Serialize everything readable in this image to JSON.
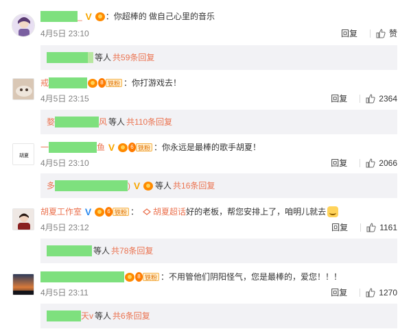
{
  "comments": [
    {
      "text": "：你超棒的 做自己心里的音乐",
      "time": "4月5日 23:10",
      "reply": "回复",
      "likes": "赞",
      "sub_who": "等人",
      "sub_count": "共59条回复"
    },
    {
      "name_prefix": "戒",
      "fan_tag": "铁粉",
      "text": "：你打游戏去！",
      "time": "4月5日 23:15",
      "reply": "回复",
      "likes": "2364",
      "sub_prefix": "婺",
      "sub_suffix": "风",
      "sub_who": "等人",
      "sub_count": "共110条回复"
    },
    {
      "name_prefix": "一",
      "name_suffix": "鱼",
      "fan_tag": "铁粉",
      "text": "：你永远是最棒的歌手胡夏！",
      "time": "4月5日 23:10",
      "reply": "回复",
      "likes": "2066",
      "sub_prefix": "多",
      "sub_who": "等人",
      "sub_count": "共16条回复"
    },
    {
      "name": "胡夏工作室",
      "fan_tag": "铁粉",
      "chaohua": "胡夏超话",
      "text": " 好的老板，帮您安排上了，咱明儿就去",
      "time": "4月5日 23:12",
      "reply": "回复",
      "likes": "1161",
      "sub_who": "等人",
      "sub_count": "共78条回复"
    },
    {
      "fan_tag": "铁粉",
      "text": "：不用管他们阴阳怪气，您是最棒的，爱您！！！",
      "time": "4月5日 23:11",
      "reply": "回复",
      "likes": "1270",
      "sub_suffix": "天v",
      "sub_who": "等人",
      "sub_count": "共6条回复"
    }
  ],
  "icons": {
    "verified": "v-badge-icon",
    "thumb": "thumb-up-icon",
    "crown": "crown-icon"
  },
  "colors": {
    "accent": "#eb7350",
    "time": "#808080",
    "subbg": "#f2f2f5",
    "mask": "#7ee07e"
  }
}
